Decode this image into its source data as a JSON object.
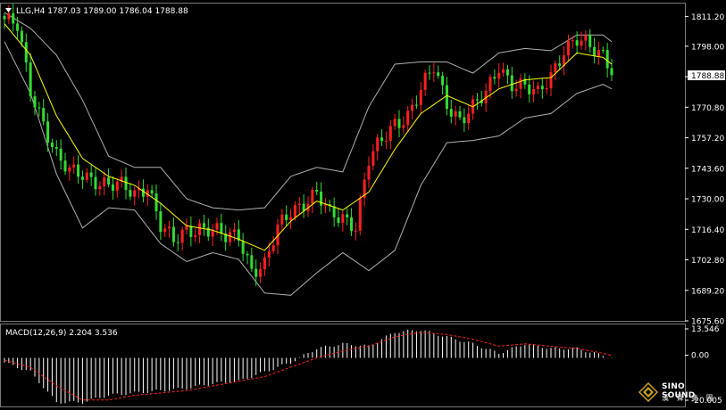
{
  "header": {
    "symbol_line": "LLG,H4  1787.03 1789.00 1786.04 1788.88",
    "macd_line": "MACD(12,26,9) 2.204 3.536"
  },
  "price_axis": {
    "ticks": [
      "1811.20",
      "1798.00",
      "1784.40",
      "1770.80",
      "1757.20",
      "1743.60",
      "1730.00",
      "1716.40",
      "1702.80",
      "1689.20",
      "1675.60"
    ],
    "current_price": "1788.88"
  },
  "macd_axis": {
    "ticks": [
      "13.546",
      "0.00",
      "-20.005"
    ]
  },
  "logo": {
    "line1": "SINO SOUND",
    "line2": "漢 聲 集 團"
  },
  "colors": {
    "background": "#000000",
    "bull_candle": "#ff2020",
    "bear_candle": "#33dd33",
    "ma_line": "#ffff00",
    "bollinger": "#b0b0b0",
    "macd_hist": "#ffffff",
    "macd_signal": "#ff2020",
    "grid_text": "#ffffff"
  },
  "chart_data": {
    "type": "candlestick",
    "symbol": "LLG",
    "timeframe": "H4",
    "current": {
      "open": 1787.03,
      "high": 1789.0,
      "low": 1786.04,
      "close": 1788.88
    },
    "ylim": [
      1675.6,
      1817.0
    ],
    "close_path": [
      [
        0,
        1810
      ],
      [
        3,
        1806
      ],
      [
        6,
        1778
      ],
      [
        9,
        1765
      ],
      [
        12,
        1749
      ],
      [
        15,
        1741
      ],
      [
        18,
        1741
      ],
      [
        21,
        1739
      ],
      [
        24,
        1736
      ],
      [
        27,
        1735
      ],
      [
        30,
        1732
      ],
      [
        33,
        1737
      ],
      [
        36,
        1718
      ],
      [
        39,
        1710
      ],
      [
        42,
        1716
      ],
      [
        45,
        1718
      ],
      [
        48,
        1716
      ],
      [
        51,
        1712
      ],
      [
        54,
        1714
      ],
      [
        57,
        1699
      ],
      [
        60,
        1700
      ],
      [
        63,
        1716
      ],
      [
        66,
        1725
      ],
      [
        69,
        1729
      ],
      [
        72,
        1732
      ],
      [
        75,
        1722
      ],
      [
        78,
        1722
      ],
      [
        81,
        1719
      ],
      [
        84,
        1747
      ],
      [
        87,
        1755
      ],
      [
        90,
        1764
      ],
      [
        93,
        1768
      ],
      [
        96,
        1778
      ],
      [
        99,
        1788
      ],
      [
        102,
        1773
      ],
      [
        105,
        1766
      ],
      [
        108,
        1770
      ],
      [
        111,
        1776
      ],
      [
        114,
        1790
      ],
      [
        117,
        1782
      ],
      [
        120,
        1779
      ],
      [
        123,
        1776
      ],
      [
        126,
        1786
      ],
      [
        129,
        1797
      ],
      [
        132,
        1800
      ],
      [
        135,
        1797
      ],
      [
        138,
        1795
      ],
      [
        140,
        1789
      ]
    ],
    "ma_path": [
      [
        0,
        1808
      ],
      [
        6,
        1794
      ],
      [
        12,
        1767
      ],
      [
        18,
        1748
      ],
      [
        24,
        1740
      ],
      [
        30,
        1736
      ],
      [
        36,
        1728
      ],
      [
        42,
        1718
      ],
      [
        48,
        1716
      ],
      [
        54,
        1712
      ],
      [
        60,
        1707
      ],
      [
        66,
        1720
      ],
      [
        72,
        1729
      ],
      [
        78,
        1725
      ],
      [
        84,
        1733
      ],
      [
        90,
        1752
      ],
      [
        96,
        1768
      ],
      [
        102,
        1776
      ],
      [
        108,
        1771
      ],
      [
        114,
        1779
      ],
      [
        120,
        1783
      ],
      [
        126,
        1784
      ],
      [
        132,
        1795
      ],
      [
        138,
        1793
      ],
      [
        140,
        1790
      ]
    ],
    "bb_upper": [
      [
        0,
        1813
      ],
      [
        6,
        1806
      ],
      [
        12,
        1794
      ],
      [
        18,
        1774
      ],
      [
        24,
        1749
      ],
      [
        30,
        1744
      ],
      [
        36,
        1744
      ],
      [
        42,
        1730
      ],
      [
        48,
        1726
      ],
      [
        54,
        1725
      ],
      [
        60,
        1726
      ],
      [
        66,
        1740
      ],
      [
        72,
        1744
      ],
      [
        78,
        1742
      ],
      [
        84,
        1771
      ],
      [
        90,
        1790
      ],
      [
        96,
        1791
      ],
      [
        102,
        1791
      ],
      [
        108,
        1786
      ],
      [
        114,
        1795
      ],
      [
        120,
        1797
      ],
      [
        126,
        1796
      ],
      [
        132,
        1803
      ],
      [
        138,
        1803
      ],
      [
        140,
        1800
      ]
    ],
    "bb_lower": [
      [
        0,
        1800
      ],
      [
        6,
        1777
      ],
      [
        12,
        1741
      ],
      [
        18,
        1717
      ],
      [
        24,
        1726
      ],
      [
        30,
        1725
      ],
      [
        36,
        1710
      ],
      [
        42,
        1702
      ],
      [
        48,
        1706
      ],
      [
        54,
        1703
      ],
      [
        60,
        1688
      ],
      [
        66,
        1687
      ],
      [
        72,
        1697
      ],
      [
        78,
        1706
      ],
      [
        84,
        1698
      ],
      [
        90,
        1707
      ],
      [
        96,
        1736
      ],
      [
        102,
        1755
      ],
      [
        108,
        1756
      ],
      [
        114,
        1758
      ],
      [
        120,
        1766
      ],
      [
        126,
        1768
      ],
      [
        132,
        1777
      ],
      [
        138,
        1781
      ],
      [
        140,
        1779
      ]
    ],
    "macd": {
      "name": "MACD(12,26,9)",
      "main": 2.204,
      "signal": 3.536,
      "ylim": [
        -20.005,
        13.546
      ],
      "hist_path": [
        [
          0,
          -2
        ],
        [
          6,
          -6
        ],
        [
          12,
          -19
        ],
        [
          18,
          -19
        ],
        [
          24,
          -16
        ],
        [
          30,
          -15
        ],
        [
          36,
          -14
        ],
        [
          42,
          -13
        ],
        [
          48,
          -11
        ],
        [
          54,
          -10
        ],
        [
          60,
          -6
        ],
        [
          66,
          -2
        ],
        [
          72,
          4
        ],
        [
          78,
          6
        ],
        [
          84,
          5
        ],
        [
          90,
          11
        ],
        [
          96,
          12
        ],
        [
          102,
          9
        ],
        [
          108,
          6
        ],
        [
          114,
          2
        ],
        [
          120,
          6
        ],
        [
          126,
          4
        ],
        [
          132,
          4
        ],
        [
          138,
          1
        ],
        [
          140,
          0
        ]
      ],
      "signal_path": [
        [
          0,
          -1
        ],
        [
          6,
          -4
        ],
        [
          12,
          -12
        ],
        [
          18,
          -18
        ],
        [
          24,
          -18
        ],
        [
          30,
          -16
        ],
        [
          36,
          -15
        ],
        [
          42,
          -14
        ],
        [
          48,
          -12
        ],
        [
          54,
          -10
        ],
        [
          60,
          -8
        ],
        [
          66,
          -4
        ],
        [
          72,
          0
        ],
        [
          78,
          3
        ],
        [
          84,
          5
        ],
        [
          90,
          9
        ],
        [
          96,
          11
        ],
        [
          102,
          10
        ],
        [
          108,
          8
        ],
        [
          114,
          5
        ],
        [
          120,
          6
        ],
        [
          126,
          5
        ],
        [
          132,
          4
        ],
        [
          138,
          2
        ],
        [
          140,
          1
        ]
      ]
    }
  }
}
